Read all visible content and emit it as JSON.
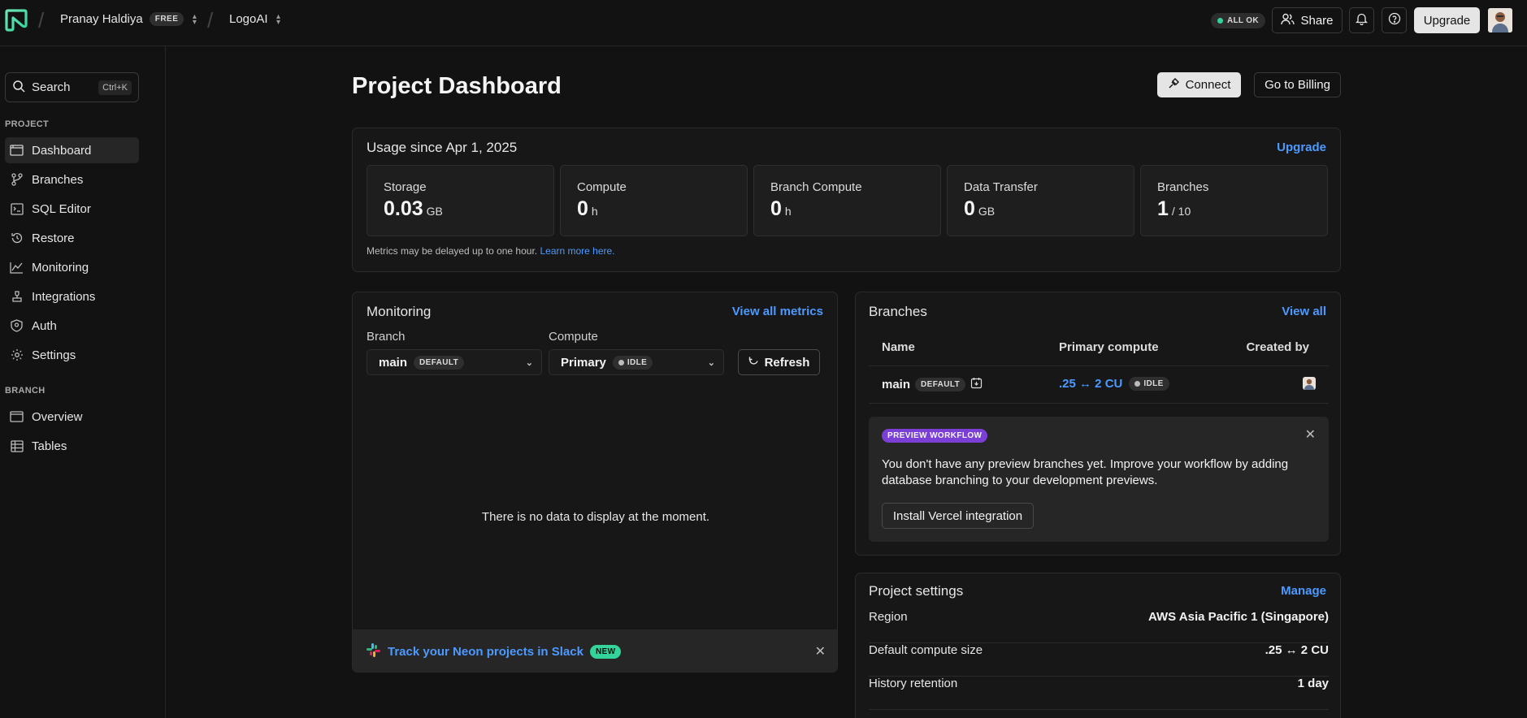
{
  "topbar": {
    "user_name": "Pranay Haldiya",
    "plan_badge": "FREE",
    "project_name": "LogoAI",
    "status_label": "ALL OK",
    "share_label": "Share",
    "upgrade_label": "Upgrade",
    "icons": [
      "neon-logo-icon",
      "chevron-up-down-icon",
      "users-icon",
      "bell-icon",
      "help-icon",
      "avatar"
    ]
  },
  "sidebar": {
    "search_label": "Search",
    "search_shortcut": "Ctrl+K",
    "project_section": "PROJECT",
    "project_items": [
      {
        "label": "Dashboard",
        "icon": "dashboard-icon"
      },
      {
        "label": "Branches",
        "icon": "branch-icon"
      },
      {
        "label": "SQL Editor",
        "icon": "sql-editor-icon"
      },
      {
        "label": "Restore",
        "icon": "restore-icon"
      },
      {
        "label": "Monitoring",
        "icon": "monitoring-icon"
      },
      {
        "label": "Integrations",
        "icon": "integrations-icon"
      },
      {
        "label": "Auth",
        "icon": "auth-icon"
      },
      {
        "label": "Settings",
        "icon": "settings-icon"
      }
    ],
    "branch_section": "BRANCH",
    "branch_items": [
      {
        "label": "Overview",
        "icon": "overview-icon"
      },
      {
        "label": "Tables",
        "icon": "tables-icon"
      }
    ]
  },
  "main": {
    "title": "Project Dashboard",
    "connect_label": "Connect",
    "billing_label": "Go to Billing",
    "usage": {
      "title": "Usage since Apr 1, 2025",
      "upgrade_link": "Upgrade",
      "metrics": [
        {
          "label": "Storage",
          "value": "0.03",
          "unit": "GB"
        },
        {
          "label": "Compute",
          "value": "0",
          "unit": "h"
        },
        {
          "label": "Branch Compute",
          "value": "0",
          "unit": "h"
        },
        {
          "label": "Data Transfer",
          "value": "0",
          "unit": "GB"
        },
        {
          "label": "Branches",
          "value": "1",
          "unit": "/ 10"
        }
      ],
      "note": "Metrics may be delayed up to one hour.",
      "note_link": "Learn more here."
    },
    "monitoring": {
      "title": "Monitoring",
      "view_all": "View all metrics",
      "branch_label": "Branch",
      "branch_value": "main",
      "branch_badge": "DEFAULT",
      "compute_label": "Compute",
      "compute_value": "Primary",
      "compute_badge": "IDLE",
      "refresh_label": "Refresh",
      "empty_text": "There is no data to display at the moment.",
      "slack_text": "Track your Neon projects in Slack",
      "slack_badge": "NEW"
    },
    "branches": {
      "title": "Branches",
      "view_all": "View all",
      "col_name": "Name",
      "col_compute": "Primary compute",
      "col_created": "Created by",
      "row": {
        "name": "main",
        "badge": "DEFAULT",
        "compute": ".25 ↔ 2 CU",
        "status": "IDLE"
      },
      "preview_badge": "PREVIEW WORKFLOW",
      "preview_text": "You don't have any preview branches yet. Improve your workflow by adding database branching to your development previews.",
      "install_label": "Install Vercel integration"
    },
    "project_settings": {
      "title": "Project settings",
      "manage_link": "Manage",
      "rows": [
        {
          "key": "Region",
          "value": "AWS Asia Pacific 1 (Singapore)"
        },
        {
          "key": "Default compute size",
          "value": ".25 ↔ 2 CU"
        },
        {
          "key": "History retention",
          "value": "1 day"
        }
      ]
    }
  },
  "colors": {
    "background": "#121212",
    "accent_link": "#4c9aff",
    "logo_green": "#34d399",
    "purple_badge": "#7b3fd6"
  }
}
